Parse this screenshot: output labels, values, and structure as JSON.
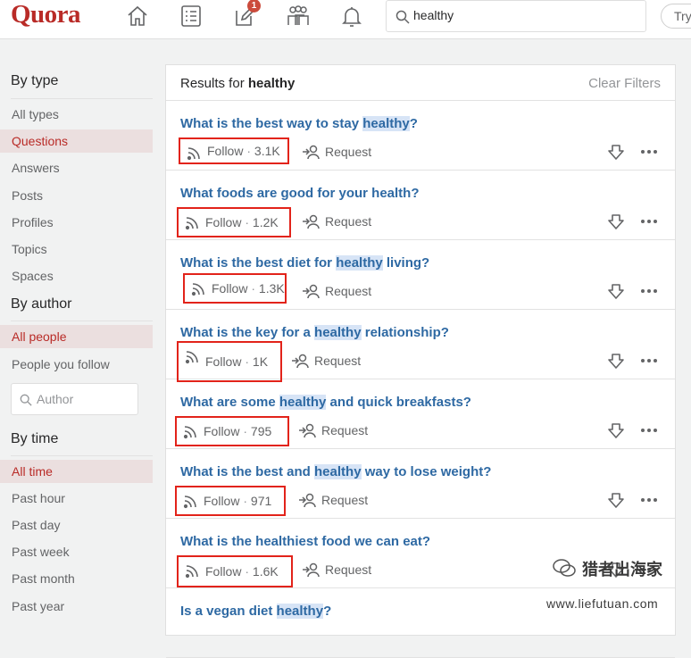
{
  "header": {
    "logo": "Quora",
    "notifications_count": "1",
    "search_value": "healthy",
    "try_label": "Try"
  },
  "sidebar": {
    "by_type_title": "By type",
    "type_items": [
      "All types",
      "Questions",
      "Answers",
      "Posts",
      "Profiles",
      "Topics",
      "Spaces"
    ],
    "by_author_title": "By author",
    "author_items": [
      "All people",
      "People you follow"
    ],
    "author_placeholder": "Author",
    "by_time_title": "By time",
    "time_items": [
      "All time",
      "Past hour",
      "Past day",
      "Past week",
      "Past month",
      "Past year"
    ]
  },
  "results": {
    "results_for_label": "Results for",
    "query": "healthy",
    "clear_filters": "Clear Filters",
    "follow_label": "Follow",
    "request_label": "Request",
    "questions": [
      {
        "before": "What is the best way to stay ",
        "highlight": "healthy",
        "after": "?",
        "follow_count": "3.1K"
      },
      {
        "before": "What foods are good for your health?",
        "highlight": "",
        "after": "",
        "follow_count": "1.2K"
      },
      {
        "before": "What is the best diet for ",
        "highlight": "healthy",
        "after": " living?",
        "follow_count": "1.3K"
      },
      {
        "before": "What is the key for a ",
        "highlight": "healthy",
        "after": " relationship?",
        "follow_count": "1K"
      },
      {
        "before": "What are some ",
        "highlight": "healthy",
        "after": " and quick breakfasts?",
        "follow_count": "795"
      },
      {
        "before": "What is the best and ",
        "highlight": "healthy",
        "after": " way to lose weight?",
        "follow_count": "971"
      },
      {
        "before": "What is the healthiest food we can eat?",
        "highlight": "",
        "after": "",
        "follow_count": "1.6K"
      },
      {
        "before": "Is a vegan diet ",
        "highlight": "healthy",
        "after": "?",
        "follow_count": ""
      }
    ]
  },
  "watermark": {
    "line1": "猎者出海家",
    "line2": "www.liefutuan.com"
  },
  "colors": {
    "brand": "#b92b27",
    "link": "#2e69a3",
    "highlight": "#d7e4f6",
    "annotation_box": "#e2231a",
    "active_filter_bg": "#ebdfdf"
  },
  "icons": [
    "home-icon",
    "answer-list-icon",
    "write-icon",
    "spaces-icon",
    "bell-icon",
    "search-icon",
    "follow-feed-icon",
    "request-person-icon",
    "downvote-icon",
    "more-dots-icon"
  ]
}
